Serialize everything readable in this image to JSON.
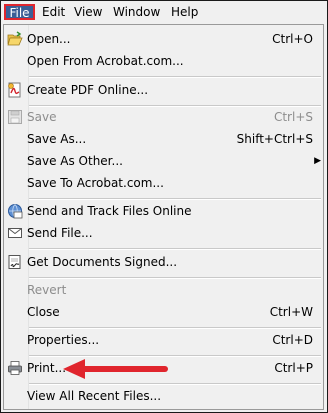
{
  "menubar": {
    "items": [
      "File",
      "Edit",
      "View",
      "Window",
      "Help"
    ]
  },
  "menu": {
    "items": [
      {
        "label": "Open...",
        "shortcut": "Ctrl+O",
        "icon": "folder-open-icon"
      },
      {
        "label": "Open From Acrobat.com...",
        "shortcut": ""
      },
      {
        "label": "Create PDF Online...",
        "shortcut": "",
        "icon": "create-pdf-icon"
      },
      {
        "label": "Save",
        "shortcut": "Ctrl+S",
        "icon": "save-icon",
        "disabled": true
      },
      {
        "label": "Save As...",
        "shortcut": "Shift+Ctrl+S"
      },
      {
        "label": "Save As Other...",
        "shortcut": "",
        "submenu": true
      },
      {
        "label": "Save To Acrobat.com...",
        "shortcut": ""
      },
      {
        "label": "Send and Track Files Online",
        "shortcut": "",
        "icon": "send-track-icon"
      },
      {
        "label": "Send File...",
        "shortcut": "",
        "icon": "envelope-icon"
      },
      {
        "label": "Get Documents Signed...",
        "shortcut": "",
        "icon": "sign-icon"
      },
      {
        "label": "Revert",
        "shortcut": "",
        "disabled": true
      },
      {
        "label": "Close",
        "shortcut": "Ctrl+W"
      },
      {
        "label": "Properties...",
        "shortcut": "Ctrl+D"
      },
      {
        "label": "Print...",
        "shortcut": "Ctrl+P",
        "icon": "printer-icon"
      },
      {
        "label": "View All Recent Files...",
        "shortcut": ""
      }
    ]
  },
  "colors": {
    "menu_bg": "#f0f0f0",
    "file_highlight": "#3b5f96",
    "annotation_red": "#e0252d",
    "disabled_text": "#8d8d8d"
  }
}
